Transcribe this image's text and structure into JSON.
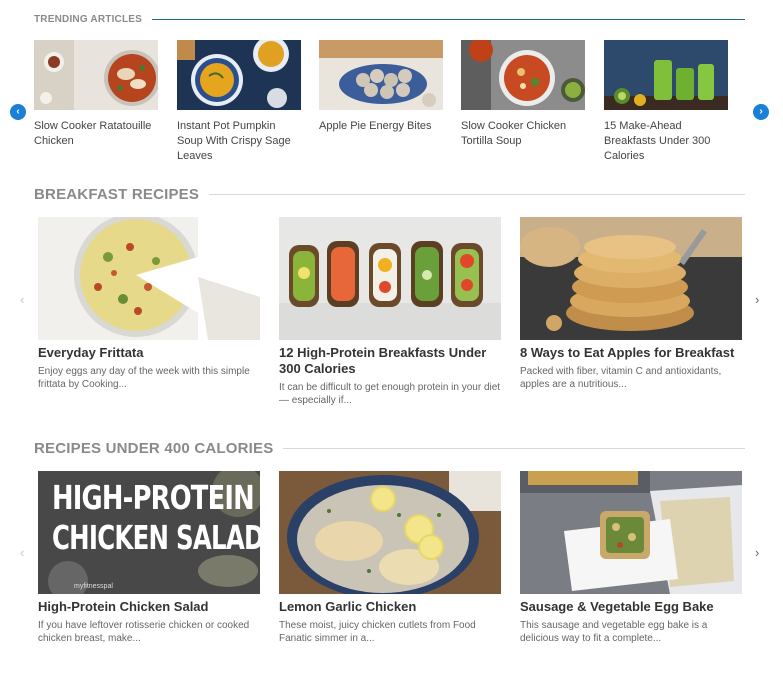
{
  "trending": {
    "title": "TRENDING ARTICLES",
    "articles": [
      {
        "label": "Slow Cooker Ratatouille Chicken"
      },
      {
        "label": "Instant Pot Pumpkin Soup With Crispy Sage Leaves"
      },
      {
        "label": "Apple Pie Energy Bites"
      },
      {
        "label": "Slow Cooker Chicken Tortilla Soup"
      },
      {
        "label": "15 Make-Ahead Breakfasts Under 300 Calories"
      }
    ],
    "prev_icon": "‹",
    "next_icon": "›"
  },
  "breakfast": {
    "title": "BREAKFAST RECIPES",
    "cards": [
      {
        "title": "Everyday Frittata",
        "desc": "Enjoy eggs any day of the week with this simple frittata by Cooking..."
      },
      {
        "title": "12 High-Protein Breakfasts Under 300 Calories",
        "desc": "It can be difficult to get enough protein in your diet — especially if..."
      },
      {
        "title": "8 Ways to Eat Apples for Breakfast",
        "desc": "Packed with fiber, vitamin C and antioxidants, apples are a nutritious..."
      }
    ],
    "prev_icon": "‹",
    "next_icon": "›"
  },
  "under400": {
    "title": "RECIPES UNDER 400 CALORIES",
    "cards": [
      {
        "title": "High-Protein Chicken Salad",
        "desc": "If you have leftover rotisserie chicken or cooked chicken breast, make...",
        "overlay1": "HIGH-PROTEIN",
        "overlay2": "CHICKEN SALAD",
        "watermark": "myfitnesspal"
      },
      {
        "title": "Lemon Garlic Chicken",
        "desc": "These moist, juicy chicken cutlets from Food Fanatic simmer in a..."
      },
      {
        "title": "Sausage & Vegetable Egg Bake",
        "desc": "This sausage and vegetable egg bake is a delicious way to fit a complete..."
      }
    ],
    "prev_icon": "‹",
    "next_icon": "›"
  },
  "colors": {
    "accent": "#1a7fd6",
    "trend_rule": "#1a6a7a",
    "rule": "#d9d9d9",
    "heading": "#8a8a8a"
  }
}
